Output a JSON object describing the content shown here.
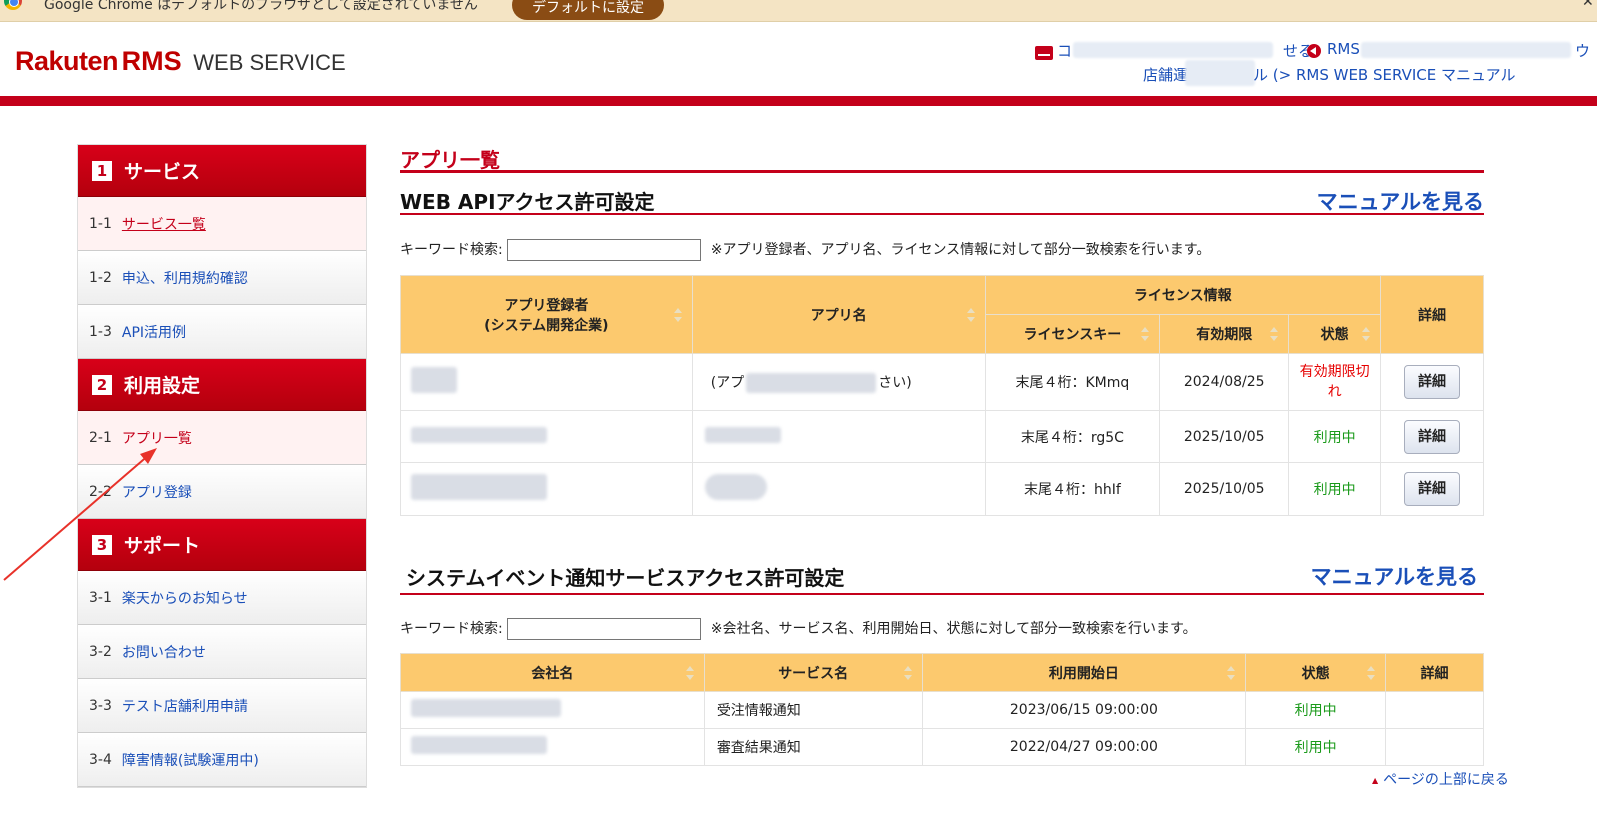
{
  "infobar": {
    "message": "Google Chrome はデフォルトのブラウザとして設定されていません",
    "button": "デフォルトに設定",
    "close": "✕"
  },
  "header": {
    "logo_rakuten": "Rakuten",
    "logo_rms": "RMS",
    "logo_web": "WEB SERVICE",
    "link1_start": "コ",
    "link1_end": "せる",
    "link2_start": "RMS",
    "link2_end": "ウ",
    "link3_start": "店舗運",
    "link3_end": "ル (> RMS WEB SERVICE マニュアル"
  },
  "sidebar": {
    "sections": [
      {
        "num": "1",
        "title": "サービス",
        "items": [
          {
            "code": "1-1",
            "label": "サービス一覧"
          },
          {
            "code": "1-2",
            "label": "申込、利用規約確認"
          },
          {
            "code": "1-3",
            "label": "API活用例"
          }
        ]
      },
      {
        "num": "2",
        "title": "利用設定",
        "items": [
          {
            "code": "2-1",
            "label": "アプリ一覧"
          },
          {
            "code": "2-2",
            "label": "アプリ登録"
          }
        ]
      },
      {
        "num": "3",
        "title": "サポート",
        "items": [
          {
            "code": "3-1",
            "label": "楽天からのお知らせ"
          },
          {
            "code": "3-2",
            "label": "お問い合わせ"
          },
          {
            "code": "3-3",
            "label": "テスト店舗利用申請"
          },
          {
            "code": "3-4",
            "label": "障害情報(試験運用中)"
          }
        ]
      }
    ]
  },
  "main": {
    "page_title": "アプリ一覧",
    "api": {
      "title": "WEB APIアクセス許可設定",
      "manual": "マニュアルを見る",
      "kw_label": "キーワード検索:",
      "kw_note": "※アプリ登録者、アプリ名、ライセンス情報に対して部分一致検索を行います。",
      "headers": {
        "registrant_line1": "アプリ登録者",
        "registrant_line2": "(システム開発企業)",
        "app_name": "アプリ名",
        "license": "ライセンス情報",
        "license_key": "ライセンスキー",
        "expiry": "有効期限",
        "status": "状態",
        "detail": "詳細"
      },
      "rows": [
        {
          "app_name_start": "(アプ",
          "app_name_end": "さい)",
          "key": "末尾４桁：KMmq",
          "expiry": "2024/08/25",
          "status_line1": "有効期限切",
          "status_line2": "れ",
          "detail": "詳細"
        },
        {
          "key": "末尾４桁：rg5C",
          "expiry": "2025/10/05",
          "status": "利用中",
          "detail": "詳細"
        },
        {
          "key": "末尾４桁：hhIf",
          "expiry": "2025/10/05",
          "status": "利用中",
          "detail": "詳細"
        }
      ]
    },
    "event": {
      "title": "システムイベント通知サービスアクセス許可設定",
      "manual": "マニュアルを見る",
      "kw_label": "キーワード検索:",
      "kw_note": "※会社名、サービス名、利用開始日、状態に対して部分一致検索を行います。",
      "headers": {
        "company": "会社名",
        "service": "サービス名",
        "start": "利用開始日",
        "status": "状態",
        "detail": "詳細"
      },
      "rows": [
        {
          "service": "受注情報通知",
          "start": "2023/06/15 09:00:00",
          "status": "利用中"
        },
        {
          "service": "審査結果通知",
          "start": "2022/04/27 09:00:00",
          "status": "利用中"
        }
      ]
    },
    "back_to_top": "ページの上部に戻る"
  },
  "colors": {
    "brand_red": "#c4001a",
    "header_orange": "#fcc96e",
    "link_blue": "#1a4fb8",
    "status_green": "#1a9a1a",
    "annotation_arrow": "#e8322a"
  }
}
